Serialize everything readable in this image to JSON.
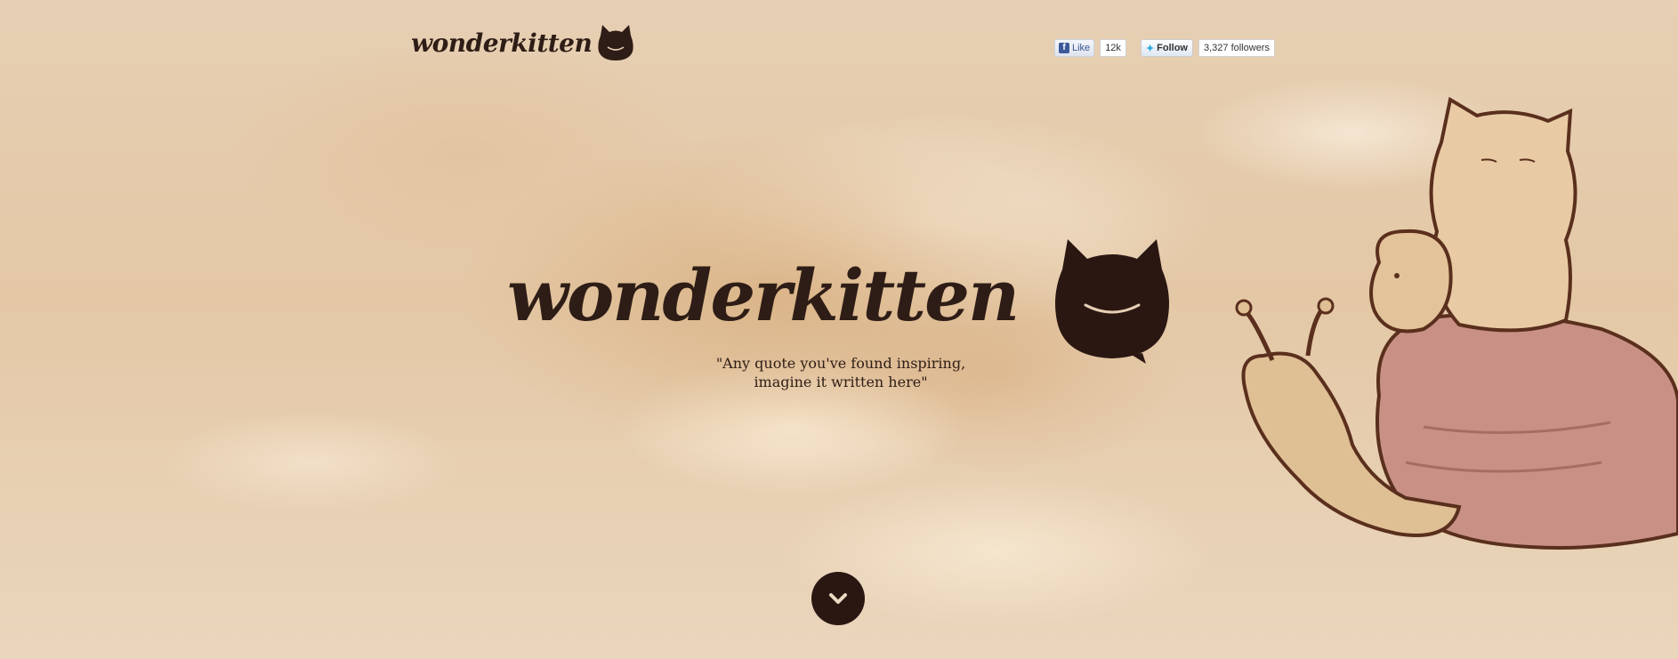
{
  "header": {
    "logo_text": "wonderkitten"
  },
  "social": {
    "like_label": "Like",
    "like_count": "12k",
    "follow_label": "Follow",
    "followers_count": "3,327 followers"
  },
  "hero": {
    "title": "wonderkitten",
    "quote_line1": "\"Any quote you've found inspiring,",
    "quote_line2": "imagine it written here\""
  },
  "icons": {
    "logo": "kitten-silhouette-icon",
    "scroll": "chevron-down-icon",
    "facebook": "facebook-icon",
    "twitter": "twitter-bird-icon"
  },
  "colors": {
    "ink": "#2e1d16",
    "background": "#e6cfb3",
    "facebook": "#3b5998",
    "twitter": "#2aa9e0"
  }
}
